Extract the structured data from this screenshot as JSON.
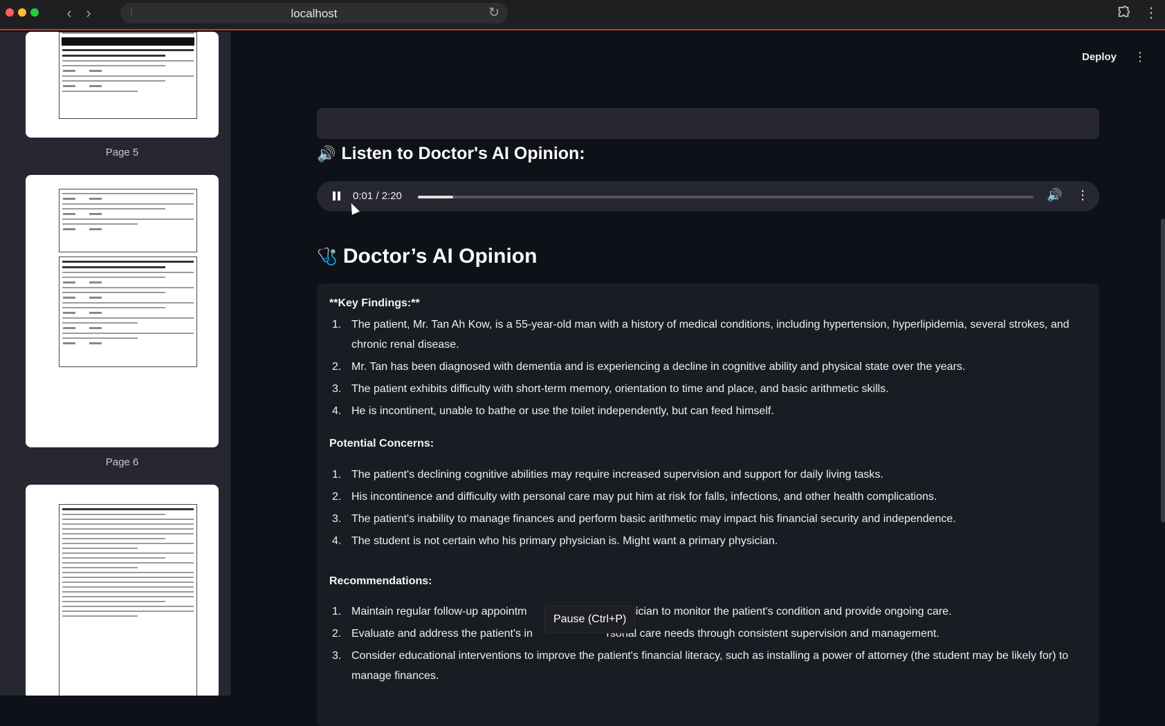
{
  "browser": {
    "url": "localhost"
  },
  "sidebar": {
    "pages": [
      {
        "label": "Page 5"
      },
      {
        "label": "Page 6"
      }
    ]
  },
  "header": {
    "deploy_label": "Deploy"
  },
  "audio_section": {
    "heading": "Listen to Doctor's AI Opinion:",
    "time_display": "0:01 / 2:20",
    "progress_fraction": 0.057
  },
  "opinion": {
    "heading": "Doctor’s AI Opinion",
    "key_findings_title": "**Key Findings:**",
    "key_findings": [
      {
        "num": "1.",
        "text": "The patient, Mr. Tan Ah Kow, is a 55-year-old man with a history of medical conditions, including hypertension, hyperlipidemia, several strokes, and chronic renal disease."
      },
      {
        "num": "2.",
        "text": "Mr. Tan has been diagnosed with dementia and is experiencing a decline in cognitive ability and physical state over the years."
      },
      {
        "num": "3.",
        "text": "The patient exhibits difficulty with short-term memory, orientation to time and place, and basic arithmetic skills."
      },
      {
        "num": "4.",
        "text": "He is incontinent, unable to bathe or use the toilet independently, but can feed himself."
      }
    ],
    "concerns_title": "Potential Concerns:",
    "concerns": [
      {
        "num": "1.",
        "text": "The patient's declining cognitive abilities may require increased supervision and support for daily living tasks."
      },
      {
        "num": "2.",
        "text": "His incontinence and difficulty with personal care may put him at risk for falls, infections, and other health complications."
      },
      {
        "num": "3.",
        "text": "The patient's inability to manage finances and perform basic arithmetic may impact his financial security and independence."
      },
      {
        "num": "4.",
        "text": "The student is not certain who his primary physician is. Might want a primary physician."
      }
    ],
    "recommendations_title": "Recommendations:",
    "recommendations": [
      {
        "num": "1.",
        "text": "Maintain regular follow-up appointm                         y physician to monitor the patient's condition and provide ongoing care."
      },
      {
        "num": "2.",
        "text": "Evaluate and address the patient's in                        rsonal care needs through consistent supervision and management."
      },
      {
        "num": "3.",
        "text": "Consider educational interventions to improve the patient's financial literacy, such as installing a power of attorney (the student may be likely for) to manage finances."
      }
    ]
  },
  "tooltip": {
    "text": "Pause (Ctrl+P)"
  }
}
